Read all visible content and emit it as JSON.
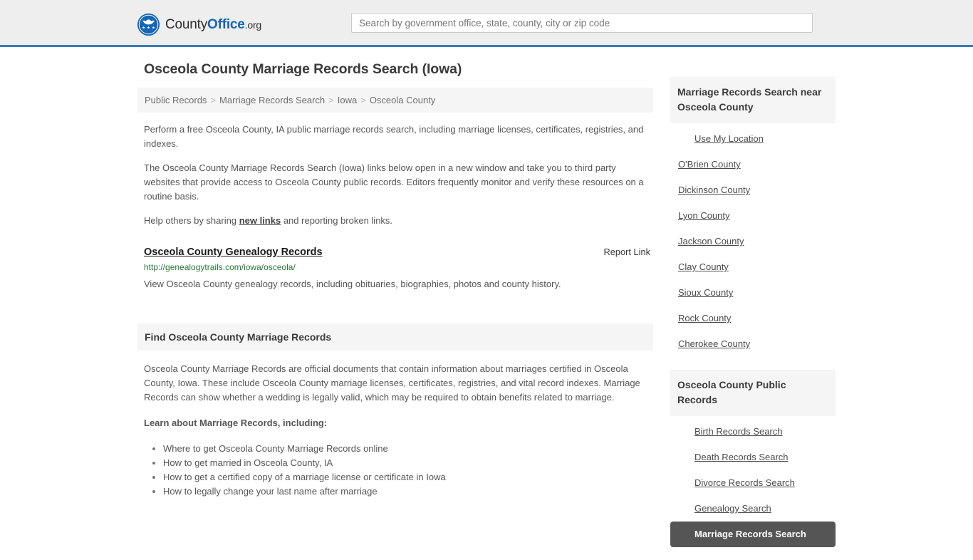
{
  "header": {
    "logo": {
      "icon": "eagle-seal-icon",
      "part1": "County",
      "part2": "Office",
      "part3": ".org"
    },
    "search": {
      "placeholder": "Search by government office, state, county, city or zip code",
      "value": ""
    }
  },
  "page": {
    "title": "Osceola County Marriage Records Search (Iowa)"
  },
  "breadcrumb": {
    "separator": ">",
    "items": [
      {
        "label": "Public Records"
      },
      {
        "label": "Marriage Records Search"
      },
      {
        "label": "Iowa"
      },
      {
        "label": "Osceola County"
      }
    ]
  },
  "intro": {
    "paragraph1": "Perform a free Osceola County, IA public marriage records search, including marriage licenses, certificates, registries, and indexes.",
    "paragraph2": "The Osceola County Marriage Records Search (Iowa) links below open in a new window and take you to third party websites that provide access to Osceola County public records. Editors frequently monitor and verify these resources on a routine basis.",
    "paragraph3_before": "Help others by sharing ",
    "paragraph3_link": "new links",
    "paragraph3_after": " and reporting broken links."
  },
  "result": {
    "title": "Osceola County Genealogy Records",
    "report_label": "Report Link",
    "url": "http://genealogytrails.com/iowa/osceola/",
    "description": "View Osceola County genealogy records, including obituaries, biographies, photos and county history."
  },
  "find_section": {
    "heading": "Find Osceola County Marriage Records",
    "paragraph": "Osceola County Marriage Records are official documents that contain information about marriages certified in Osceola County, Iowa. These include Osceola County marriage licenses, certificates, registries, and vital record indexes. Marriage Records can show whether a wedding is legally valid, which may be required to obtain benefits related to marriage.",
    "learn_heading": "Learn about Marriage Records, including:",
    "bullets": [
      "Where to get Osceola County Marriage Records online",
      "How to get married in Osceola County, IA",
      "How to get a certified copy of a marriage license or certificate in Iowa",
      "How to legally change your last name after marriage"
    ]
  },
  "sidebar": {
    "nearby": {
      "heading": "Marriage Records Search near Osceola County",
      "items": [
        {
          "label": "Use My Location",
          "indented": true,
          "active": false
        },
        {
          "label": "O'Brien County",
          "indented": false,
          "active": false
        },
        {
          "label": "Dickinson County",
          "indented": false,
          "active": false
        },
        {
          "label": "Lyon County",
          "indented": false,
          "active": false
        },
        {
          "label": "Jackson County",
          "indented": false,
          "active": false
        },
        {
          "label": "Clay County",
          "indented": false,
          "active": false
        },
        {
          "label": "Sioux County",
          "indented": false,
          "active": false
        },
        {
          "label": "Rock County",
          "indented": false,
          "active": false
        },
        {
          "label": "Cherokee County",
          "indented": false,
          "active": false
        }
      ]
    },
    "public_records": {
      "heading": "Osceola County Public Records",
      "items": [
        {
          "label": "Birth Records Search",
          "indented": true,
          "active": false
        },
        {
          "label": "Death Records Search",
          "indented": true,
          "active": false
        },
        {
          "label": "Divorce Records Search",
          "indented": true,
          "active": false
        },
        {
          "label": "Genealogy Search",
          "indented": true,
          "active": false
        },
        {
          "label": "Marriage Records Search",
          "indented": true,
          "active": true
        }
      ]
    }
  },
  "colors": {
    "brand_blue": "#1566b7",
    "header_rule": "#3a7bb5",
    "panel_gray": "#f5f5f5",
    "url_green": "#2a7a3b",
    "active_dark": "#555555"
  }
}
